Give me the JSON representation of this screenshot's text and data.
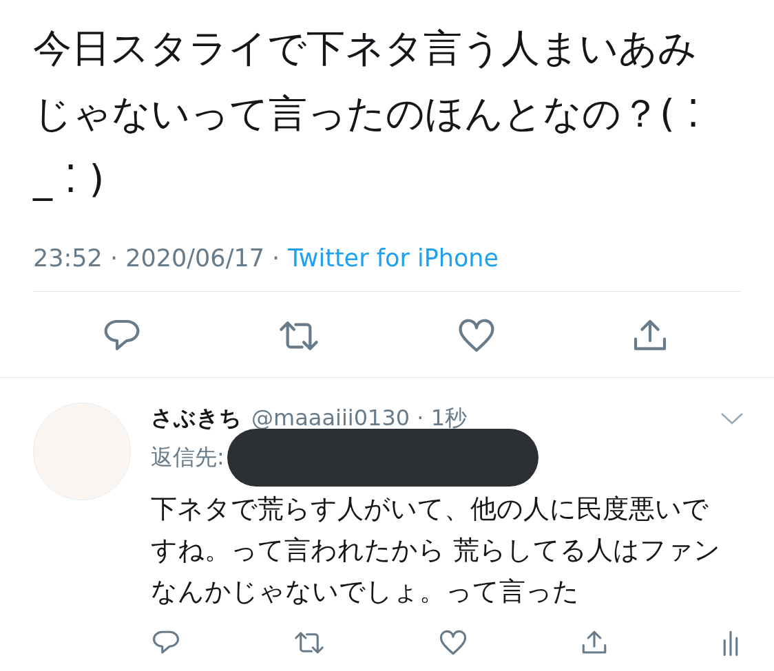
{
  "tweet": {
    "text": "今日スタライで下ネタ言う人まいあみじゃないって言ったのほんとなの？( ⁚ _ ⁚ )",
    "timestamp": "23:52 · 2020/06/17 ·",
    "source": "Twitter for iPhone"
  },
  "reply": {
    "name": "さぶきち",
    "handle_time": "@maaaiii0130 · 1秒",
    "reply_to_label": "返信先:",
    "text": "下ネタで荒らす人がいて、他の人に民度悪いですね。って言われたから 荒らしてる人はファンなんかじゃないでしょ。って言った"
  }
}
